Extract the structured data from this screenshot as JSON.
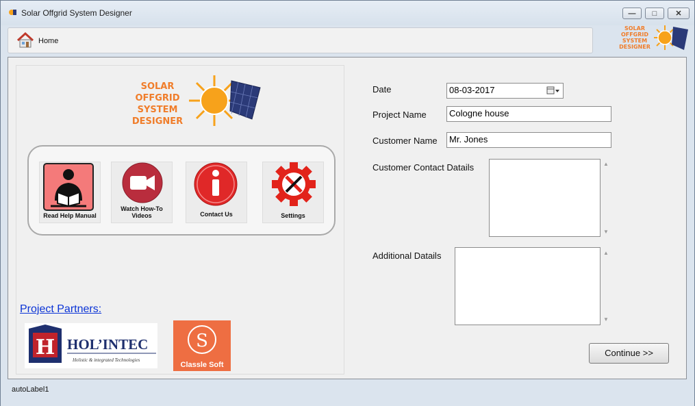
{
  "window": {
    "title": "Solar Offgrid System Designer",
    "buttons": {
      "minimize": "—",
      "maximize": "□",
      "close": "✕"
    }
  },
  "toolbar": {
    "home_label": "Home",
    "home_icon": "home-icon"
  },
  "logo": {
    "lines": [
      "SOLAR",
      "OFFGRID",
      "SYSTEM",
      "DESIGNER"
    ]
  },
  "tiles": [
    {
      "label_lines": [
        "Read Help Manual"
      ],
      "icon": "reader-icon"
    },
    {
      "label_lines": [
        "Watch How-To",
        "Videos"
      ],
      "icon": "video-camera-icon"
    },
    {
      "label_lines": [
        "Contact Us"
      ],
      "icon": "info-icon"
    },
    {
      "label_lines": [
        "Settings"
      ],
      "icon": "settings-gear-icon"
    }
  ],
  "partners": {
    "title": "Project Partners:",
    "holintec": {
      "name": "HOL’INTEC",
      "tagline": "Holistic & integrated Technologies",
      "mark": "H"
    },
    "classle": {
      "name": "Classle Soft",
      "mark": "S"
    }
  },
  "form": {
    "date": {
      "label": "Date",
      "value": "08-03-2017"
    },
    "project_name": {
      "label": "Project Name",
      "value": "Cologne house"
    },
    "customer_name": {
      "label": "Customer Name",
      "value": "Mr. Jones"
    },
    "customer_contact": {
      "label": "Customer Contact Datails",
      "value": ""
    },
    "additional": {
      "label": "Additional Datails",
      "value": ""
    },
    "continue_label": "Continue >>"
  },
  "status": {
    "text": "autoLabel1"
  },
  "colors": {
    "orange": "#f07d2a",
    "sun": "#f7a21b",
    "red_tile": "#f47a7a",
    "maroon": "#b92d3d",
    "info_red": "#e02828",
    "gear_red": "#e2231a",
    "link_blue": "#0a33d6"
  }
}
